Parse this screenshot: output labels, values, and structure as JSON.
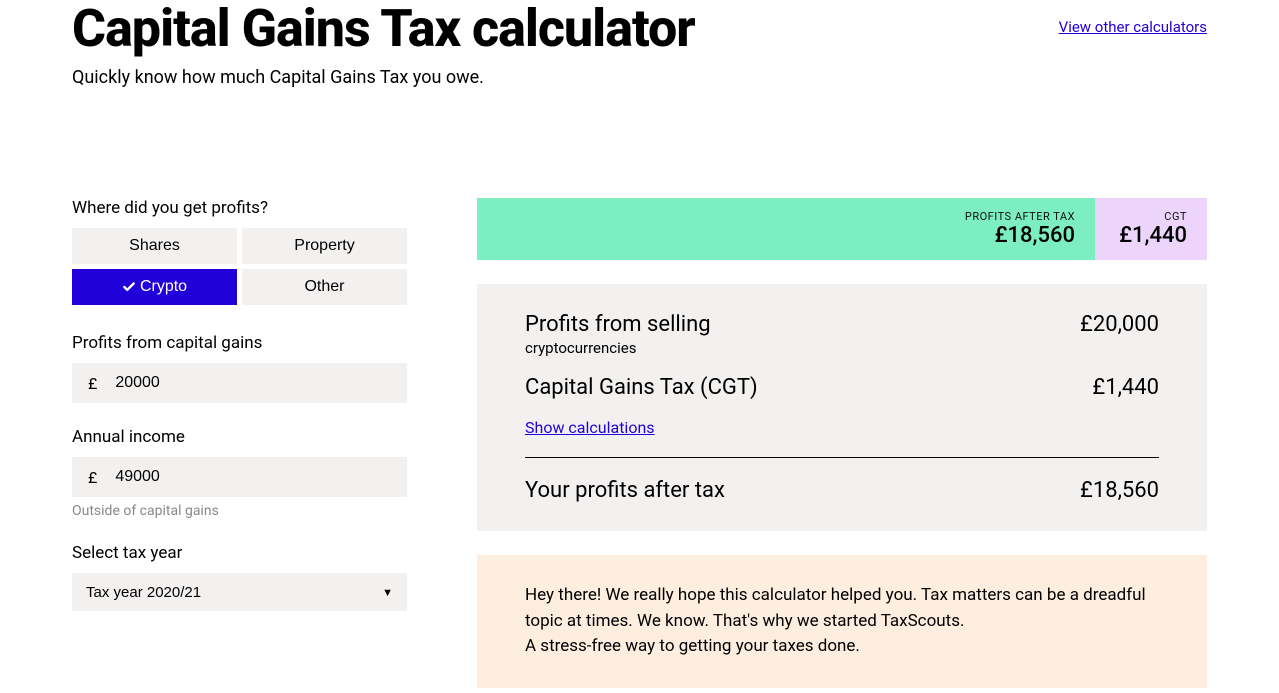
{
  "header": {
    "title": "Capital Gains Tax calculator",
    "view_other_link": "View other calculators",
    "subtitle": "Quickly know how much Capital Gains Tax you owe."
  },
  "form": {
    "profits_source": {
      "label": "Where did you get profits?",
      "options": {
        "shares": "Shares",
        "property": "Property",
        "crypto": "Crypto",
        "other": "Other"
      },
      "selected": "crypto"
    },
    "profits_amount": {
      "label": "Profits from capital gains",
      "currency": "£",
      "value": "20000"
    },
    "annual_income": {
      "label": "Annual income",
      "currency": "£",
      "value": "49000",
      "helper": "Outside of capital gains"
    },
    "tax_year": {
      "label": "Select tax year",
      "selected": "Tax year 2020/21"
    }
  },
  "summary_bar": {
    "profits_after_tax": {
      "label": "PROFITS AFTER TAX",
      "value": "£18,560"
    },
    "cgt": {
      "label": "CGT",
      "value": "£1,440"
    }
  },
  "results": {
    "profits_from_selling": {
      "label": "Profits from selling",
      "sublabel": "cryptocurrencies",
      "value": "£20,000"
    },
    "cgt": {
      "label": "Capital Gains Tax (CGT)",
      "value": "£1,440"
    },
    "show_calculations": "Show calculations",
    "profits_after_tax": {
      "label": "Your profits after tax",
      "value": "£18,560"
    }
  },
  "promo": {
    "line1": "Hey there! We really hope this calculator helped you. Tax matters can be a dreadful topic at times. We know. That's why we started TaxScouts.",
    "line2": "A stress-free way to getting your taxes done."
  }
}
